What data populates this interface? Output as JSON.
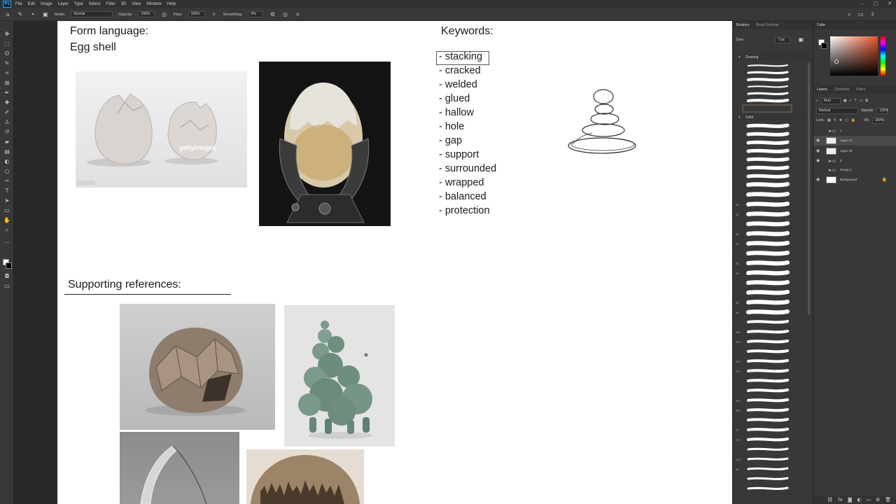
{
  "menu": [
    "File",
    "Edit",
    "Image",
    "Layer",
    "Type",
    "Select",
    "Filter",
    "3D",
    "View",
    "Window",
    "Help"
  ],
  "options": {
    "mode_label": "Mode:",
    "mode_value": "Normal",
    "opacity_label": "Opacity:",
    "opacity_value": "100%",
    "flow_label": "Flow:",
    "flow_value": "100%",
    "smoothing_label": "Smoothing:",
    "smoothing_value": "0%"
  },
  "canvas": {
    "form_heading": "Form language:",
    "form_subject": "Egg shell",
    "keywords_heading": "Keywords:",
    "keywords": [
      "- stacking",
      "- cracked",
      "- welded",
      "- glued",
      "- hallow",
      "- hole",
      "- gap",
      "- support",
      "- surrounded",
      "- wrapped",
      "- balanced",
      "- protection"
    ],
    "supporting_heading": "Supporting references:",
    "getty_watermark": "gettyimages"
  },
  "brushes": {
    "tabs": [
      "Brushes",
      "Brush Settings"
    ],
    "size_label": "Size:",
    "size_value": "7 px",
    "folders": [
      "Drawing",
      "Solid"
    ],
    "numbers": [
      "30",
      "50",
      "35",
      "25",
      "30",
      "30",
      "35",
      "45",
      "150",
      "100",
      "100",
      "270",
      "300",
      "250",
      "75",
      "175",
      "125",
      "60",
      "15",
      "290",
      "125",
      "115",
      "200",
      "300",
      "120"
    ]
  },
  "color_panel": {
    "tab": "Color"
  },
  "layers_panel": {
    "tabs": [
      "Layers",
      "Channels",
      "Paths"
    ],
    "kind_label": "Kind",
    "blend_mode": "Normal",
    "opacity_label": "Opacity:",
    "opacity_value": "100%",
    "lock_label": "Lock:",
    "fill_label": "Fill:",
    "fill_value": "100%",
    "layers": [
      {
        "name": "1",
        "type": "group"
      },
      {
        "name": "Layer 21",
        "type": "layer",
        "selected": true
      },
      {
        "name": "Layer 20",
        "type": "layer"
      },
      {
        "name": "2",
        "type": "group"
      },
      {
        "name": "Group 2",
        "type": "group"
      },
      {
        "name": "Background",
        "type": "background"
      }
    ]
  },
  "colors": {
    "canvas_bg": "#ffffff",
    "chrome": "#383838",
    "accent": "#31a8ff",
    "text": "#1a1a1a"
  }
}
